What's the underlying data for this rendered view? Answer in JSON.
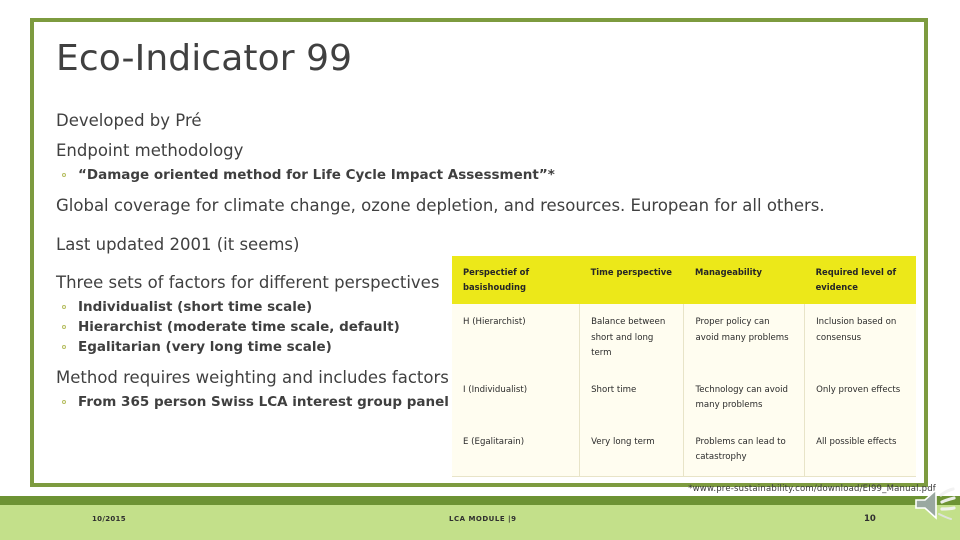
{
  "slide": {
    "title": "Eco-Indicator 99",
    "bullets": [
      {
        "level": 1,
        "text": "Developed by Pré"
      },
      {
        "level": 1,
        "text": "Endpoint methodology"
      },
      {
        "level": 2,
        "text": "“Damage oriented method for Life Cycle Impact Assessment”*"
      },
      {
        "level": 1,
        "text": "Global coverage for climate change, ozone depletion, and resources. European for all others."
      },
      {
        "level": 1,
        "text": "Last updated 2001 (it seems)"
      },
      {
        "level": 1,
        "text": "Three sets of factors for different perspectives"
      },
      {
        "level": 2,
        "text": "Individualist (short time scale)"
      },
      {
        "level": 2,
        "text": "Hierarchist (moderate time scale, default)"
      },
      {
        "level": 2,
        "text": "Egalitarian  (very long time scale)"
      },
      {
        "level": 1,
        "text": "Method requires weighting and includes factors"
      },
      {
        "level": 2,
        "text": "From 365 person Swiss LCA interest group panel"
      }
    ],
    "footnote": "*www.pre-sustainability.com/download/EI99_Manual.pdf"
  },
  "table": {
    "headers": [
      "Perspectief of basishouding",
      "Time perspective",
      "Manageability",
      "Required level of evidence"
    ],
    "rows": [
      {
        "perspective": "H (Hierarchist)",
        "time": "Balance between short and long term",
        "manageability": "Proper policy can avoid many problems",
        "evidence": "Inclusion based on consensus"
      },
      {
        "perspective": "I (Individualist)",
        "time": "Short time",
        "manageability": "Technology can avoid many problems",
        "evidence": "Only proven effects"
      },
      {
        "perspective": "E (Egalitarain)",
        "time": "Very long term",
        "manageability": "Problems can lead to catastrophy",
        "evidence": "All  possible effects"
      }
    ],
    "header_bg": "#ece819",
    "body_bg": "#fffdf0"
  },
  "footer": {
    "date": "10/2015",
    "module": "LCA MODULE |9",
    "page_number": "10",
    "bar_dark_color": "#6d9334",
    "bar_light_color": "#c3e08a"
  },
  "theme": {
    "frame_color": "#7d9b3f",
    "title_color": "#404040",
    "bullet_marker_color": "#b5bd5e"
  }
}
